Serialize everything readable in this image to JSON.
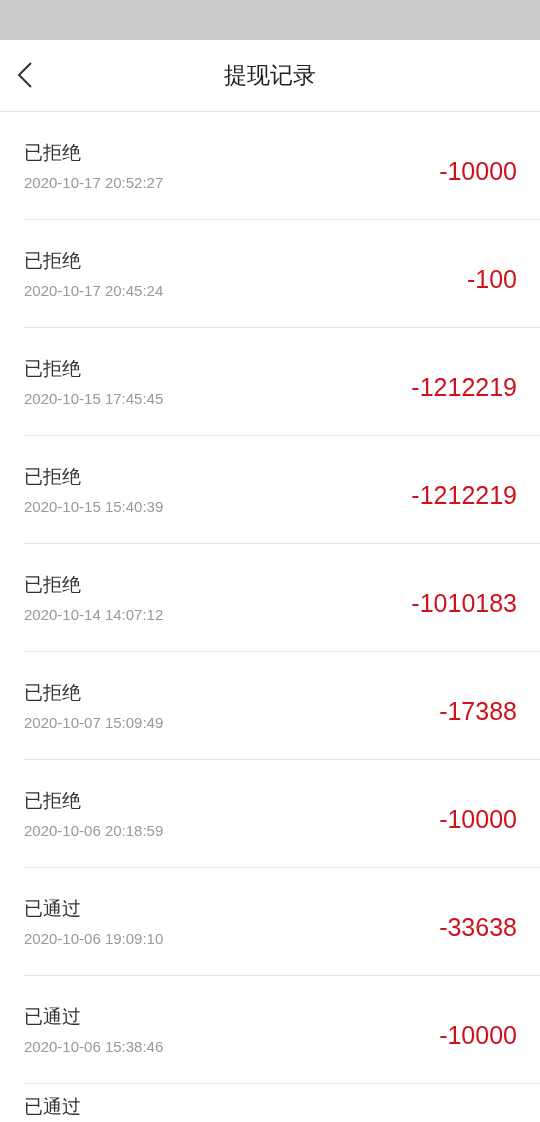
{
  "header": {
    "title": "提现记录"
  },
  "records": [
    {
      "status": "已拒绝",
      "time": "2020-10-17 20:52:27",
      "amount": "-10000"
    },
    {
      "status": "已拒绝",
      "time": "2020-10-17 20:45:24",
      "amount": "-100"
    },
    {
      "status": "已拒绝",
      "time": "2020-10-15 17:45:45",
      "amount": "-1212219"
    },
    {
      "status": "已拒绝",
      "time": "2020-10-15 15:40:39",
      "amount": "-1212219"
    },
    {
      "status": "已拒绝",
      "time": "2020-10-14 14:07:12",
      "amount": "-1010183"
    },
    {
      "status": "已拒绝",
      "time": "2020-10-07 15:09:49",
      "amount": "-17388"
    },
    {
      "status": "已拒绝",
      "time": "2020-10-06 20:18:59",
      "amount": "-10000"
    },
    {
      "status": "已通过",
      "time": "2020-10-06 19:09:10",
      "amount": "-33638"
    },
    {
      "status": "已通过",
      "time": "2020-10-06 15:38:46",
      "amount": "-10000"
    },
    {
      "status": "已通过"
    }
  ]
}
